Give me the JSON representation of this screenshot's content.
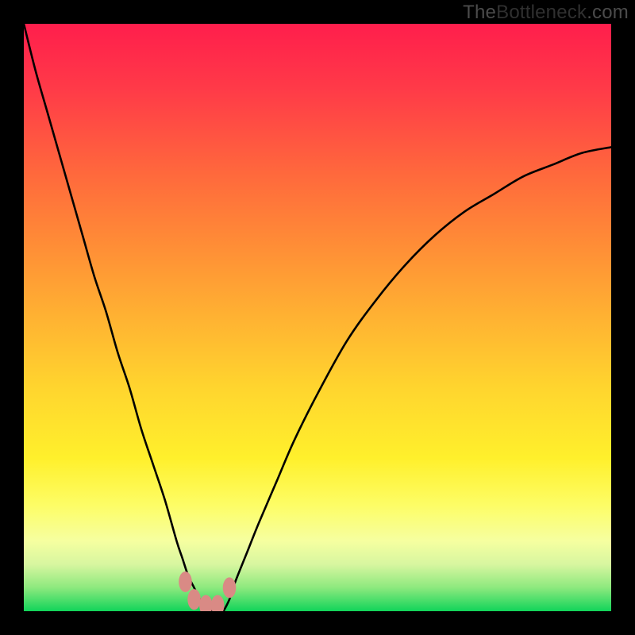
{
  "watermark": {
    "prefix": "The",
    "accent": "Bottleneck",
    "suffix": ".com"
  },
  "chart_data": {
    "type": "line",
    "title": "",
    "xlabel": "",
    "ylabel": "",
    "xlim": [
      0,
      100
    ],
    "ylim": [
      0,
      100
    ],
    "grid": false,
    "legend": false,
    "background_gradient": [
      {
        "pos": 0,
        "color": "#ff1e4c"
      },
      {
        "pos": 50,
        "color": "#ffb232"
      },
      {
        "pos": 80,
        "color": "#fff02c"
      },
      {
        "pos": 100,
        "color": "#11d45a"
      }
    ],
    "series": [
      {
        "name": "left-curve",
        "x": [
          0,
          2,
          4,
          6,
          8,
          10,
          12,
          14,
          16,
          18,
          20,
          22,
          24,
          26,
          27,
          28,
          29,
          30,
          31,
          32
        ],
        "y": [
          100,
          92,
          85,
          78,
          71,
          64,
          57,
          51,
          44,
          38,
          31,
          25,
          19,
          12,
          9,
          6,
          4,
          2,
          1,
          0
        ]
      },
      {
        "name": "right-curve",
        "x": [
          34,
          35,
          36,
          38,
          40,
          43,
          46,
          50,
          55,
          60,
          65,
          70,
          75,
          80,
          85,
          90,
          95,
          100
        ],
        "y": [
          0,
          2,
          5,
          10,
          15,
          22,
          29,
          37,
          46,
          53,
          59,
          64,
          68,
          71,
          74,
          76,
          78,
          79
        ]
      },
      {
        "name": "bottom-markers",
        "type": "scatter",
        "points": [
          {
            "x": 27.5,
            "y": 5,
            "r": 1.6
          },
          {
            "x": 29,
            "y": 2,
            "r": 1.6
          },
          {
            "x": 31,
            "y": 1,
            "r": 1.6
          },
          {
            "x": 33,
            "y": 1,
            "r": 1.6
          },
          {
            "x": 35,
            "y": 4,
            "r": 1.6
          }
        ],
        "color": "#d98a85"
      }
    ]
  }
}
